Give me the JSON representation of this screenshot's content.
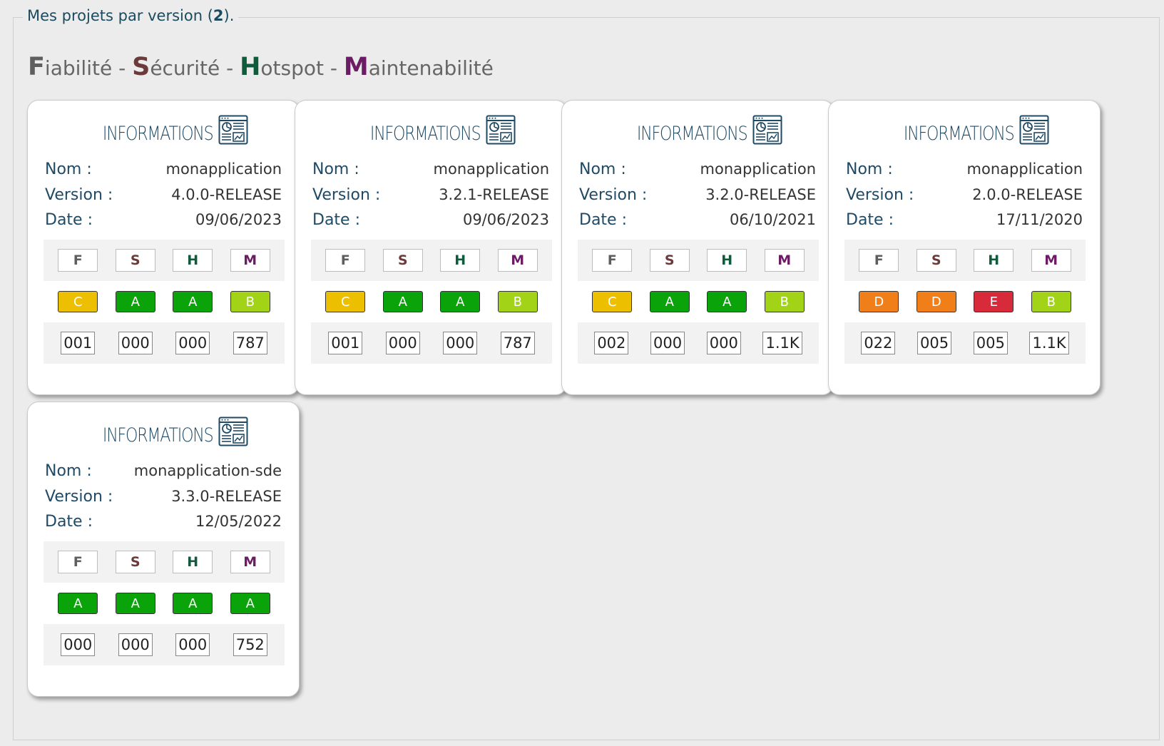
{
  "header": {
    "legend_text": "Mes projets par version (",
    "legend_count": "2",
    "legend_suffix": ").",
    "subtitle": {
      "f_initial": "F",
      "f_rest": "iabilité",
      "sep1": " - ",
      "s_initial": "S",
      "s_rest": "écurité",
      "sep2": " - ",
      "h_initial": "H",
      "h_rest": "otspot",
      "sep3": " - ",
      "m_initial": "M",
      "m_rest": "aintenabilité"
    }
  },
  "labels": {
    "card_title": "INFORMATIONS",
    "nom": "Nom :",
    "version": "Version :",
    "date": "Date :",
    "letters": [
      "F",
      "S",
      "H",
      "M"
    ]
  },
  "letter_colors": [
    "#5e5e5e",
    "#6b3a3a",
    "#0f5b3c",
    "#6b1c64"
  ],
  "grade_colors": {
    "A": "#0aa30a",
    "B": "#a3d316",
    "C": "#ecc000",
    "D": "#f07f1a",
    "E": "#d72a3a"
  },
  "cards": [
    {
      "nom": "monapplication",
      "version": "4.0.0-RELEASE",
      "date": "09/06/2023",
      "grades": [
        "C",
        "A",
        "A",
        "B"
      ],
      "counts": [
        "001",
        "000",
        "000",
        "787"
      ]
    },
    {
      "nom": "monapplication",
      "version": "3.2.1-RELEASE",
      "date": "09/06/2023",
      "grades": [
        "C",
        "A",
        "A",
        "B"
      ],
      "counts": [
        "001",
        "000",
        "000",
        "787"
      ]
    },
    {
      "nom": "monapplication",
      "version": "3.2.0-RELEASE",
      "date": "06/10/2021",
      "grades": [
        "C",
        "A",
        "A",
        "B"
      ],
      "counts": [
        "002",
        "000",
        "000",
        "1.1K"
      ]
    },
    {
      "nom": "monapplication",
      "version": "2.0.0-RELEASE",
      "date": "17/11/2020",
      "grades": [
        "D",
        "D",
        "E",
        "B"
      ],
      "counts": [
        "022",
        "005",
        "005",
        "1.1K"
      ]
    },
    {
      "nom": "monapplication-sde",
      "version": "3.3.0-RELEASE",
      "date": "12/05/2022",
      "grades": [
        "A",
        "A",
        "A",
        "A"
      ],
      "counts": [
        "000",
        "000",
        "000",
        "752"
      ]
    }
  ]
}
